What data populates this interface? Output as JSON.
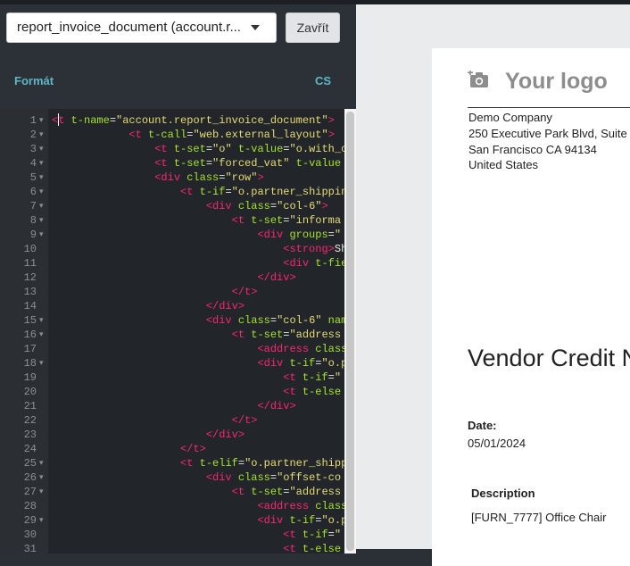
{
  "toolbar": {
    "report_select_value": "report_invoice_document (account.r...",
    "close_label": "Zavřít"
  },
  "tabs": {
    "format": "Formát",
    "language": "CS"
  },
  "editor": {
    "lines": [
      {
        "n": "1",
        "f": true,
        "segs": [
          [
            "t",
            "<t"
          ],
          [
            "a",
            " t-name"
          ],
          [
            "p",
            "="
          ],
          [
            "s",
            "\"account.report_invoice_document\""
          ],
          [
            "t",
            ">"
          ]
        ]
      },
      {
        "n": "2",
        "f": true,
        "segs": [
          [
            "p",
            "            "
          ],
          [
            "t",
            "<t"
          ],
          [
            "a",
            " t-call"
          ],
          [
            "p",
            "="
          ],
          [
            "s",
            "\"web.external_layout\""
          ],
          [
            "t",
            ">"
          ]
        ]
      },
      {
        "n": "3",
        "f": true,
        "segs": [
          [
            "p",
            "                "
          ],
          [
            "t",
            "<t"
          ],
          [
            "a",
            " t-set"
          ],
          [
            "p",
            "="
          ],
          [
            "s",
            "\"o\""
          ],
          [
            "a",
            " t-value"
          ],
          [
            "p",
            "="
          ],
          [
            "s",
            "\"o.with_c"
          ]
        ]
      },
      {
        "n": "4",
        "f": true,
        "segs": [
          [
            "p",
            "                "
          ],
          [
            "t",
            "<t"
          ],
          [
            "a",
            " t-set"
          ],
          [
            "p",
            "="
          ],
          [
            "s",
            "\"forced_vat\""
          ],
          [
            "a",
            " t-value"
          ]
        ]
      },
      {
        "n": "5",
        "f": true,
        "segs": [
          [
            "p",
            "                "
          ],
          [
            "t",
            "<div"
          ],
          [
            "a",
            " class"
          ],
          [
            "p",
            "="
          ],
          [
            "s",
            "\"row\""
          ],
          [
            "t",
            ">"
          ]
        ]
      },
      {
        "n": "6",
        "f": true,
        "segs": [
          [
            "p",
            "                    "
          ],
          [
            "t",
            "<t"
          ],
          [
            "a",
            " t-if"
          ],
          [
            "p",
            "="
          ],
          [
            "s",
            "\"o.partner_shippin"
          ]
        ]
      },
      {
        "n": "7",
        "f": true,
        "segs": [
          [
            "p",
            "                        "
          ],
          [
            "t",
            "<div"
          ],
          [
            "a",
            " class"
          ],
          [
            "p",
            "="
          ],
          [
            "s",
            "\"col-6\""
          ],
          [
            "t",
            ">"
          ]
        ]
      },
      {
        "n": "8",
        "f": true,
        "segs": [
          [
            "p",
            "                            "
          ],
          [
            "t",
            "<t"
          ],
          [
            "a",
            " t-set"
          ],
          [
            "p",
            "="
          ],
          [
            "s",
            "\"informa"
          ]
        ]
      },
      {
        "n": "9",
        "f": true,
        "segs": [
          [
            "p",
            "                                "
          ],
          [
            "t",
            "<div"
          ],
          [
            "a",
            " groups"
          ],
          [
            "p",
            "="
          ],
          [
            "s",
            "\""
          ]
        ]
      },
      {
        "n": "10",
        "f": false,
        "segs": [
          [
            "p",
            "                                    "
          ],
          [
            "t",
            "<strong"
          ],
          [
            "t",
            ">"
          ],
          [
            "p",
            "Sh"
          ]
        ]
      },
      {
        "n": "11",
        "f": false,
        "segs": [
          [
            "p",
            "                                    "
          ],
          [
            "t",
            "<div"
          ],
          [
            "a",
            " t-fie"
          ]
        ]
      },
      {
        "n": "12",
        "f": false,
        "segs": [
          [
            "p",
            "                                "
          ],
          [
            "t",
            "</div"
          ],
          [
            "t",
            ">"
          ]
        ]
      },
      {
        "n": "13",
        "f": false,
        "segs": [
          [
            "p",
            "                            "
          ],
          [
            "t",
            "</t"
          ],
          [
            "t",
            ">"
          ]
        ]
      },
      {
        "n": "14",
        "f": false,
        "segs": [
          [
            "p",
            "                        "
          ],
          [
            "t",
            "</div"
          ],
          [
            "t",
            ">"
          ]
        ]
      },
      {
        "n": "15",
        "f": true,
        "segs": [
          [
            "p",
            "                        "
          ],
          [
            "t",
            "<div"
          ],
          [
            "a",
            " class"
          ],
          [
            "p",
            "="
          ],
          [
            "s",
            "\"col-6\""
          ],
          [
            "a",
            " nam"
          ]
        ]
      },
      {
        "n": "16",
        "f": true,
        "segs": [
          [
            "p",
            "                            "
          ],
          [
            "t",
            "<t"
          ],
          [
            "a",
            " t-set"
          ],
          [
            "p",
            "="
          ],
          [
            "s",
            "\"address"
          ]
        ]
      },
      {
        "n": "17",
        "f": false,
        "segs": [
          [
            "p",
            "                                "
          ],
          [
            "t",
            "<address"
          ],
          [
            "a",
            " class"
          ]
        ]
      },
      {
        "n": "18",
        "f": true,
        "segs": [
          [
            "p",
            "                                "
          ],
          [
            "t",
            "<div"
          ],
          [
            "a",
            " t-if"
          ],
          [
            "p",
            "="
          ],
          [
            "s",
            "\"o.p"
          ]
        ]
      },
      {
        "n": "19",
        "f": false,
        "segs": [
          [
            "p",
            "                                    "
          ],
          [
            "t",
            "<t"
          ],
          [
            "a",
            " t-if"
          ],
          [
            "p",
            "="
          ],
          [
            "s",
            "\""
          ]
        ]
      },
      {
        "n": "20",
        "f": false,
        "segs": [
          [
            "p",
            "                                    "
          ],
          [
            "t",
            "<t"
          ],
          [
            "a",
            " t-else"
          ]
        ]
      },
      {
        "n": "21",
        "f": false,
        "segs": [
          [
            "p",
            "                                "
          ],
          [
            "t",
            "</div"
          ],
          [
            "t",
            ">"
          ]
        ]
      },
      {
        "n": "22",
        "f": false,
        "segs": [
          [
            "p",
            "                            "
          ],
          [
            "t",
            "</t"
          ],
          [
            "t",
            ">"
          ]
        ]
      },
      {
        "n": "23",
        "f": false,
        "segs": [
          [
            "p",
            "                        "
          ],
          [
            "t",
            "</div"
          ],
          [
            "t",
            ">"
          ]
        ]
      },
      {
        "n": "24",
        "f": false,
        "segs": [
          [
            "p",
            "                    "
          ],
          [
            "t",
            "</t"
          ],
          [
            "t",
            ">"
          ]
        ]
      },
      {
        "n": "25",
        "f": true,
        "segs": [
          [
            "p",
            "                    "
          ],
          [
            "t",
            "<t"
          ],
          [
            "a",
            " t-elif"
          ],
          [
            "p",
            "="
          ],
          [
            "s",
            "\"o.partner_shipp"
          ]
        ]
      },
      {
        "n": "26",
        "f": true,
        "segs": [
          [
            "p",
            "                        "
          ],
          [
            "t",
            "<div"
          ],
          [
            "a",
            " class"
          ],
          [
            "p",
            "="
          ],
          [
            "s",
            "\"offset-co"
          ]
        ]
      },
      {
        "n": "27",
        "f": true,
        "segs": [
          [
            "p",
            "                            "
          ],
          [
            "t",
            "<t"
          ],
          [
            "a",
            " t-set"
          ],
          [
            "p",
            "="
          ],
          [
            "s",
            "\"address"
          ]
        ]
      },
      {
        "n": "28",
        "f": false,
        "segs": [
          [
            "p",
            "                                "
          ],
          [
            "t",
            "<address"
          ],
          [
            "a",
            " class"
          ]
        ]
      },
      {
        "n": "29",
        "f": true,
        "segs": [
          [
            "p",
            "                                "
          ],
          [
            "t",
            "<div"
          ],
          [
            "a",
            " t-if"
          ],
          [
            "p",
            "="
          ],
          [
            "s",
            "\"o.p"
          ]
        ]
      },
      {
        "n": "30",
        "f": false,
        "segs": [
          [
            "p",
            "                                    "
          ],
          [
            "t",
            "<t"
          ],
          [
            "a",
            " t-if"
          ],
          [
            "p",
            "="
          ],
          [
            "s",
            "\""
          ]
        ]
      },
      {
        "n": "31",
        "f": false,
        "segs": [
          [
            "p",
            "                                    "
          ],
          [
            "t",
            "<t"
          ],
          [
            "a",
            " t-else"
          ]
        ]
      }
    ]
  },
  "preview": {
    "logo_text": "Your logo",
    "company_lines": [
      "Demo Company",
      "250 Executive Park Blvd, Suite",
      "San Francisco CA 94134",
      "United States"
    ],
    "doc_title": "Vendor Credit N",
    "date_label": "Date:",
    "date_value": "05/01/2024",
    "description_label": "Description",
    "line_item": "[FURN_7777] Office Chair"
  },
  "colors": {
    "tag": "#f92672",
    "attr": "#a6e22e",
    "string": "#e6db74",
    "tab_accent": "#5cb8c6"
  }
}
